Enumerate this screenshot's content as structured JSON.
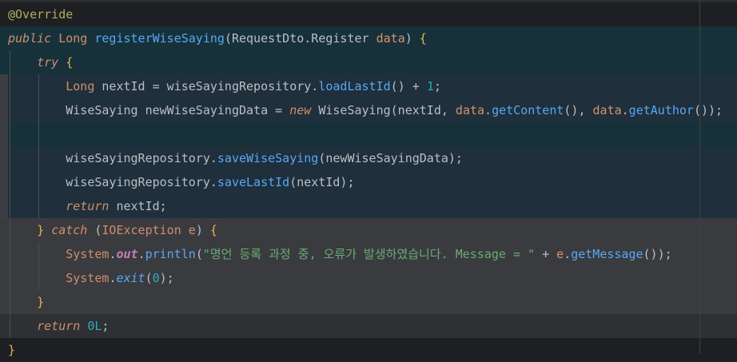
{
  "lines": [
    {
      "id": "l1",
      "tokens": [
        {
          "t": "@Override",
          "c": "ann"
        }
      ]
    },
    {
      "id": "l2",
      "tokens": [
        {
          "t": "public",
          "c": "kw"
        },
        {
          "t": " "
        },
        {
          "t": "Long",
          "c": "type"
        },
        {
          "t": " "
        },
        {
          "t": "registerWiseSaying",
          "c": "fn"
        },
        {
          "t": "("
        },
        {
          "t": "RequestDto.Register",
          "c": "cls"
        },
        {
          "t": " "
        },
        {
          "t": "data",
          "c": "param"
        },
        {
          "t": ") "
        },
        {
          "t": "{",
          "c": "brace"
        }
      ]
    },
    {
      "id": "l3",
      "tokens": [
        {
          "t": "    "
        },
        {
          "t": "try",
          "c": "kw"
        },
        {
          "t": " "
        },
        {
          "t": "{",
          "c": "brace"
        }
      ]
    },
    {
      "id": "l4",
      "tokens": [
        {
          "t": "        "
        },
        {
          "t": "Long",
          "c": "type"
        },
        {
          "t": " nextId = wiseSayingRepository."
        },
        {
          "t": "loadLastId",
          "c": "fn"
        },
        {
          "t": "() + "
        },
        {
          "t": "1",
          "c": "num"
        },
        {
          "t": ";"
        }
      ]
    },
    {
      "id": "l5",
      "tokens": [
        {
          "t": "        WiseSaying newWiseSayingData = "
        },
        {
          "t": "new",
          "c": "kw"
        },
        {
          "t": " WiseSaying(nextId, "
        },
        {
          "t": "data",
          "c": "param"
        },
        {
          "t": "."
        },
        {
          "t": "getContent",
          "c": "fn"
        },
        {
          "t": "(), "
        },
        {
          "t": "data",
          "c": "param"
        },
        {
          "t": "."
        },
        {
          "t": "getAuthor",
          "c": "fn"
        },
        {
          "t": "());"
        }
      ]
    },
    {
      "id": "l6",
      "tokens": []
    },
    {
      "id": "l7",
      "tokens": [
        {
          "t": "        wiseSayingRepository."
        },
        {
          "t": "saveWiseSaying",
          "c": "fn"
        },
        {
          "t": "(newWiseSayingData);"
        }
      ]
    },
    {
      "id": "l8",
      "tokens": [
        {
          "t": "        wiseSayingRepository."
        },
        {
          "t": "saveLastId",
          "c": "fn"
        },
        {
          "t": "(nextId);"
        }
      ]
    },
    {
      "id": "l9",
      "tokens": [
        {
          "t": "        "
        },
        {
          "t": "return",
          "c": "kw"
        },
        {
          "t": " nextId;"
        }
      ]
    },
    {
      "id": "l10",
      "tokens": [
        {
          "t": "    "
        },
        {
          "t": "}",
          "c": "brace"
        },
        {
          "t": " "
        },
        {
          "t": "catch",
          "c": "kw"
        },
        {
          "t": " ("
        },
        {
          "t": "IOException",
          "c": "type"
        },
        {
          "t": " "
        },
        {
          "t": "e",
          "c": "param"
        },
        {
          "t": ") "
        },
        {
          "t": "{",
          "c": "brace"
        }
      ]
    },
    {
      "id": "l11",
      "tokens": [
        {
          "t": "        "
        },
        {
          "t": "System",
          "c": "type"
        },
        {
          "t": "."
        },
        {
          "t": "out",
          "c": "field"
        },
        {
          "t": "."
        },
        {
          "t": "println",
          "c": "fn"
        },
        {
          "t": "("
        },
        {
          "t": "\"명언 등록 과정 중, 오류가 발생하였습니다. Message = \"",
          "c": "str"
        },
        {
          "t": " + "
        },
        {
          "t": "e",
          "c": "param"
        },
        {
          "t": "."
        },
        {
          "t": "getMessage",
          "c": "fn"
        },
        {
          "t": "());"
        }
      ]
    },
    {
      "id": "l12",
      "tokens": [
        {
          "t": "        "
        },
        {
          "t": "System",
          "c": "type"
        },
        {
          "t": "."
        },
        {
          "t": "exit",
          "c": "static"
        },
        {
          "t": "("
        },
        {
          "t": "0",
          "c": "num"
        },
        {
          "t": ");"
        }
      ]
    },
    {
      "id": "l13",
      "tokens": [
        {
          "t": "    "
        },
        {
          "t": "}",
          "c": "brace"
        }
      ]
    },
    {
      "id": "l14",
      "tokens": [
        {
          "t": "    "
        },
        {
          "t": "return",
          "c": "kw"
        },
        {
          "t": " "
        },
        {
          "t": "0L",
          "c": "num"
        },
        {
          "t": ";"
        }
      ]
    },
    {
      "id": "l15",
      "tokens": [
        {
          "t": "}",
          "c": "brace"
        }
      ]
    }
  ]
}
